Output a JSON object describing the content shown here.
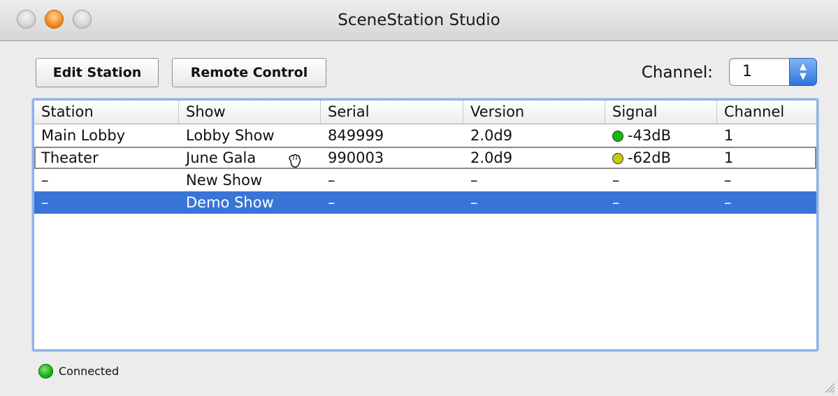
{
  "window": {
    "title": "SceneStation Studio"
  },
  "toolbar": {
    "edit_station_label": "Edit Station",
    "remote_control_label": "Remote Control",
    "channel_label": "Channel:",
    "channel_value": "1"
  },
  "table": {
    "columns": [
      "Station",
      "Show",
      "Serial",
      "Version",
      "Signal",
      "Channel"
    ],
    "rows": [
      {
        "station": "Main Lobby",
        "show": "Lobby Show",
        "serial": "849999",
        "version": "2.0d9",
        "signal": "-43dB",
        "signal_color": "#11bb11",
        "channel": "1"
      },
      {
        "station": "Theater",
        "show": "June Gala",
        "serial": "990003",
        "version": "2.0d9",
        "signal": "-62dB",
        "signal_color": "#c8c80a",
        "channel": "1"
      },
      {
        "station": "–",
        "show": "New Show",
        "serial": "–",
        "version": "–",
        "signal": "–",
        "channel": "–"
      },
      {
        "station": "–",
        "show": "Demo Show",
        "serial": "–",
        "version": "–",
        "signal": "–",
        "channel": "–"
      }
    ]
  },
  "status": {
    "text": "Connected",
    "color": "#11bb11"
  },
  "colors": {
    "selection": "#3875d7",
    "focus_ring": "#8eb3e8"
  }
}
